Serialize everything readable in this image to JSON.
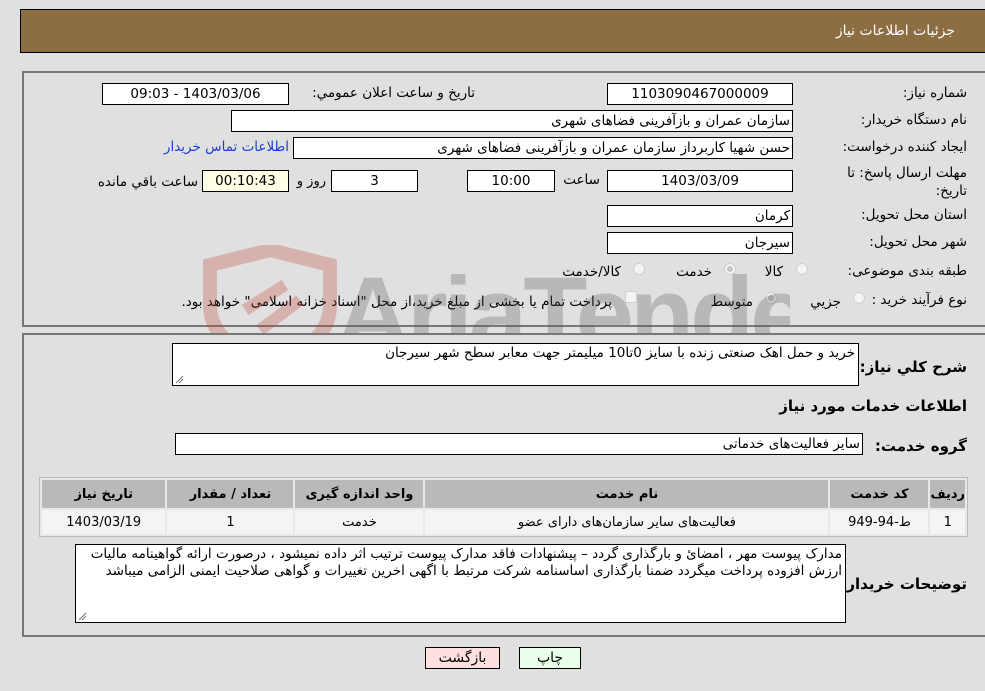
{
  "header": {
    "title": "جزئیات اطلاعات نیاز"
  },
  "form": {
    "need_number": {
      "label": "شماره نیاز:",
      "value": "1103090467000009"
    },
    "announce_datetime": {
      "label": "تاریخ و ساعت اعلان عمومي:",
      "value": "1403/03/06 - 09:03"
    },
    "buyer_org": {
      "label": "نام دستگاه خريدار:",
      "value": "سازمان عمران و بازآفرینی فضاهای شهری"
    },
    "requester": {
      "label": "ايجاد کننده درخواست:",
      "value": "حسن شهیا کاربرداز سازمان عمران و بازآفرینی فضاهای شهری"
    },
    "contact_link": "اطلاعات تماس خریدار",
    "deadline": {
      "label": "مهلت ارسال پاسخ: تا تاریخ:",
      "date": "1403/03/09",
      "time_label": "ساعت",
      "time": "10:00",
      "days": "3",
      "days_label": "روز و",
      "remaining": "00:10:43",
      "remaining_label": "ساعت باقي مانده"
    },
    "province": {
      "label": "استان محل تحويل:",
      "value": "کرمان"
    },
    "city": {
      "label": "شهر محل تحويل:",
      "value": "سیرجان"
    },
    "category": {
      "label": "طبقه بندی موضوعی:",
      "options": [
        "کالا",
        "خدمت",
        "کالا/خدمت"
      ],
      "selected": "خدمت"
    },
    "purchase_type": {
      "label": "نوع فرآیند خرید :",
      "options": [
        "جزيي",
        "متوسط"
      ],
      "selected": "متوسط",
      "treasury_checkbox_label": "پرداخت تمام یا بخشی از مبلغ خرید،از محل \"اسناد خزانه اسلامی\" خواهد بود.",
      "treasury_checked": false
    }
  },
  "details": {
    "summary_label": "شرح کلي نياز:",
    "summary_value": "خرید و حمل اهک صنعتی زنده با سایز 0تا10 میلیمتر جهت معابر سطح شهر سیرجان",
    "services_heading": "اطلاعات خدمات مورد نياز",
    "service_group_label": "گروه خدمت:",
    "service_group_value": "سایر فعالیت‌های خدماتی",
    "table": {
      "headers": [
        "رديف",
        "کد خدمت",
        "نام خدمت",
        "واحد اندازه گیری",
        "تعداد / مقدار",
        "تاریخ نیاز"
      ],
      "rows": [
        [
          "1",
          "ط-94-949",
          "فعالیت‌های سایر سازمان‌های دارای عضو",
          "خدمت",
          "1",
          "1403/03/19"
        ]
      ]
    },
    "buyer_notes_label": "توضیحات خریدار:",
    "buyer_notes_value": "مدارک پیوست مهر ، امضائ  و بارگذاری گردد – پیشنهادات فاقد مدارک پیوست ترتیب اثر داده نمیشود ، درصورت ارائه گواهینامه مالیات ارزش افزوده پرداخت میگردد ضمنا بارگذاری اساسنامه شرکت مرتبط با اگهی اخرین تغییرات و گواهی صلاحیت ایمنی الزامی میباشد"
  },
  "buttons": {
    "print": "چاپ",
    "back": "بازگشت"
  },
  "watermark": {
    "text": "AriaTender.neT"
  },
  "colors": {
    "header_bg": "#8d6e43",
    "link": "#1a3fd6",
    "back_bg": "#ffe0e0",
    "print_bg": "#eaffea",
    "countdown_bg": "#ffffe6"
  }
}
